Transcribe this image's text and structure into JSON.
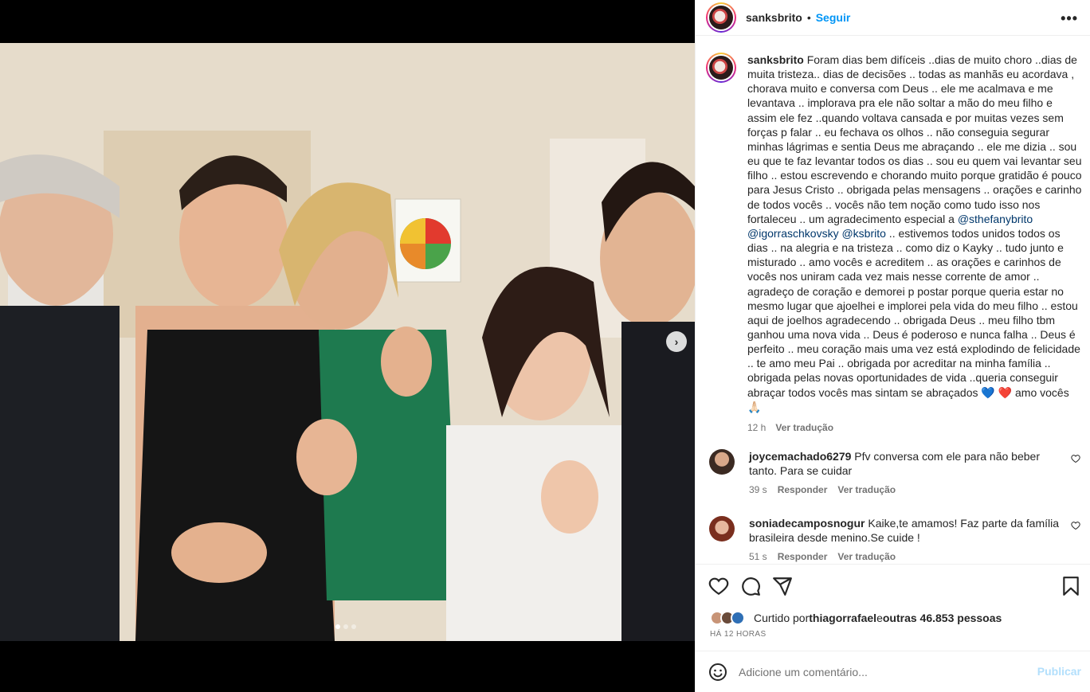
{
  "colors": {
    "accent": "#0095f6",
    "text": "#262626",
    "muted": "#737373",
    "link": "#00376b",
    "post_disabled": "#b2dffc"
  },
  "header": {
    "username": "sanksbrito",
    "separator": "•",
    "follow_label": "Seguir",
    "more_icon": "more-horizontal-icon"
  },
  "caption": {
    "username": "sanksbrito",
    "text_1": "Foram dias bem difíceis ..dias de muito choro ..dias de muita tristeza.. dias de decisões .. todas as manhãs eu acordava , chorava muito e conversa com Deus .. ele me acalmava e me levantava .. implorava pra ele não soltar a mão do meu filho e assim ele fez ..quando voltava cansada e por muitas vezes sem forças p falar .. eu fechava os olhos .. não conseguia segurar minhas lágrimas e sentia Deus me abraçando .. ele me dizia .. sou eu que te faz levantar todos os dias .. sou eu quem vai levantar seu filho .. estou escrevendo e chorando muito porque gratidão é pouco para Jesus Cristo .. obrigada pelas mensagens .. orações e carinho de todos vocês .. vocês não tem noção como tudo isso nos fortaleceu .. um agradecimento especial a ",
    "mention_1": "@sthefanybrito",
    "mention_2": "@igorraschkovsky",
    "mention_3": "@ksbrito",
    "text_2": " .. estivemos todos unidos todos os dias .. na alegria e na tristeza .. como diz o Kayky .. tudo junto e misturado .. amo vocês e acreditem .. as orações e carinhos de vocês nos uniram cada vez mais nesse corrente de amor .. agradeço de coração e demorei p postar porque queria estar no mesmo lugar que ajoelhei e implorei pela vida do meu filho .. estou aqui de joelhos agradecendo .. obrigada Deus .. meu filho tbm ganhou uma nova vida .. Deus é poderoso e nunca falha .. Deus é perfeito .. meu coração mais uma vez está explodindo de felicidade .. te amo meu Pai .. obrigada por acreditar na minha família .. obrigada pelas novas oportunidades de vida ..queria conseguir abraçar todos vocês mas sintam se abraçados 💙 ❤️ amo vocês 🙏🏻",
    "time": "12 h",
    "translate": "Ver tradução"
  },
  "comments": [
    {
      "username": "joycemachado6279",
      "text": "Pfv conversa com ele para não beber tanto. Para se cuidar",
      "time": "39 s",
      "reply": "Responder",
      "translate": "Ver tradução"
    },
    {
      "username": "soniadecamposnogur",
      "text": "Kaike,te amamos! Faz parte da família brasileira desde menino.Se cuide !",
      "time": "51 s",
      "reply": "Responder",
      "translate": "Ver tradução"
    }
  ],
  "likes": {
    "prefix": "Curtido por ",
    "user": "thiagorrafael",
    "middle": " e ",
    "others": "outras 46.853 pessoas"
  },
  "post_time": "HÁ 12 HORAS",
  "comment_box": {
    "placeholder": "Adicione um comentário...",
    "post_label": "Publicar"
  },
  "carousel": {
    "current": 1,
    "total": 3
  }
}
